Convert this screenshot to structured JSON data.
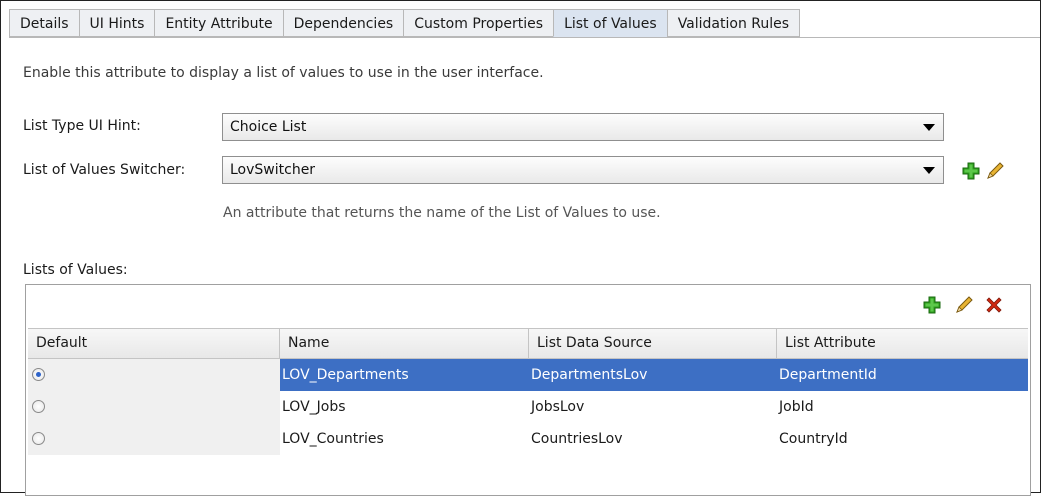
{
  "tabs": [
    {
      "label": "Details"
    },
    {
      "label": "UI Hints"
    },
    {
      "label": "Entity Attribute"
    },
    {
      "label": "Dependencies"
    },
    {
      "label": "Custom Properties"
    },
    {
      "label": "List of Values",
      "active": true
    },
    {
      "label": "Validation Rules"
    }
  ],
  "intro": "Enable this attribute to display a list of values to use in the user interface.",
  "list_type": {
    "label": "List Type UI Hint:",
    "value": "Choice List"
  },
  "switcher": {
    "label": "List of Values Switcher:",
    "value": "LovSwitcher",
    "hint": "An attribute that returns the name of the List of Values to use."
  },
  "lists_label": "Lists of Values:",
  "table": {
    "columns": [
      "Default",
      "Name",
      "List Data Source",
      "List Attribute"
    ],
    "rows": [
      {
        "default": true,
        "name": "LOV_Departments",
        "source": "DepartmentsLov",
        "attribute": "DepartmentId",
        "selected": true
      },
      {
        "default": false,
        "name": "LOV_Jobs",
        "source": "JobsLov",
        "attribute": "JobId",
        "selected": false
      },
      {
        "default": false,
        "name": "LOV_Countries",
        "source": "CountriesLov",
        "attribute": "CountryId",
        "selected": false
      }
    ]
  },
  "icons": {
    "add": "add-icon",
    "edit": "edit-pencil-icon",
    "delete": "delete-icon"
  },
  "colors": {
    "selection": "#3d6fc4",
    "add_green": "#2e9e1e",
    "delete_red": "#d22a12",
    "pencil": "#d9a21c"
  }
}
